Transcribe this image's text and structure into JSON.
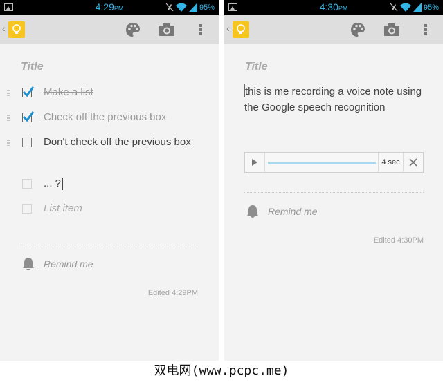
{
  "left_screen": {
    "status": {
      "time": "4:29",
      "ampm": "PM",
      "battery": "95%"
    },
    "toolbar": {
      "palette_icon": "palette-icon",
      "camera_icon": "camera-icon",
      "menu_icon": "overflow-menu-icon"
    },
    "title_placeholder": "Title",
    "items": [
      {
        "text": "Make a list",
        "checked": true
      },
      {
        "text": "Check off the previous box",
        "checked": true
      },
      {
        "text": "Don't check off the previous box",
        "checked": false
      },
      {
        "text": "... ?",
        "checked": false
      },
      {
        "text": "List item",
        "checked": false,
        "placeholder": true
      }
    ],
    "remind_label": "Remind me",
    "edited": "Edited 4:29PM"
  },
  "right_screen": {
    "status": {
      "time": "4:30",
      "ampm": "PM",
      "battery": "95%"
    },
    "title_placeholder": "Title",
    "body": "this is me recording a voice note using the Google speech recognition",
    "audio": {
      "duration": "4 sec"
    },
    "remind_label": "Remind me",
    "edited": "Edited 4:30PM"
  },
  "watermark": "双电网(www.pcpc.me)",
  "colors": {
    "accent": "#33b5e5",
    "keep_yellow": "#f7c51f",
    "check_blue": "#1a8fd0"
  }
}
